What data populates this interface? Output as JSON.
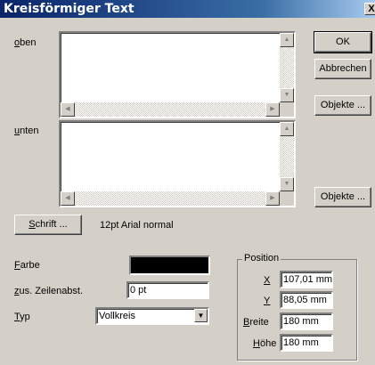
{
  "window": {
    "title": "Kreisförmiger Text",
    "close_label": "X"
  },
  "oben": {
    "label_u": "o",
    "label_rest": "ben",
    "value": ""
  },
  "unten": {
    "label_u": "u",
    "label_rest": "nten",
    "value": ""
  },
  "buttons": {
    "ok": "OK",
    "cancel": "Abbrechen",
    "objects_top": "Objekte ...",
    "objects_bottom": "Objekte ...",
    "font_u": "S",
    "font_rest": "chrift ..."
  },
  "font_info": "12pt Arial normal",
  "color": {
    "label_u": "F",
    "label_rest": "arbe",
    "swatch": "#000000"
  },
  "line_spacing": {
    "label_u": "z",
    "label_rest": "us. Zeilenabst.",
    "value": "0 pt"
  },
  "type": {
    "label_u": "T",
    "label_rest": "yp",
    "value": "Vollkreis"
  },
  "position": {
    "title": "Position",
    "x": {
      "label_u": "X",
      "label_rest": "",
      "value": "107,01 mm"
    },
    "y": {
      "label_u": "Y",
      "label_rest": "",
      "value": "88,05 mm"
    },
    "width": {
      "label_u": "B",
      "label_rest": "reite",
      "value": "180 mm"
    },
    "height": {
      "label_u": "H",
      "label_rest": "öhe",
      "value": "180 mm"
    }
  }
}
